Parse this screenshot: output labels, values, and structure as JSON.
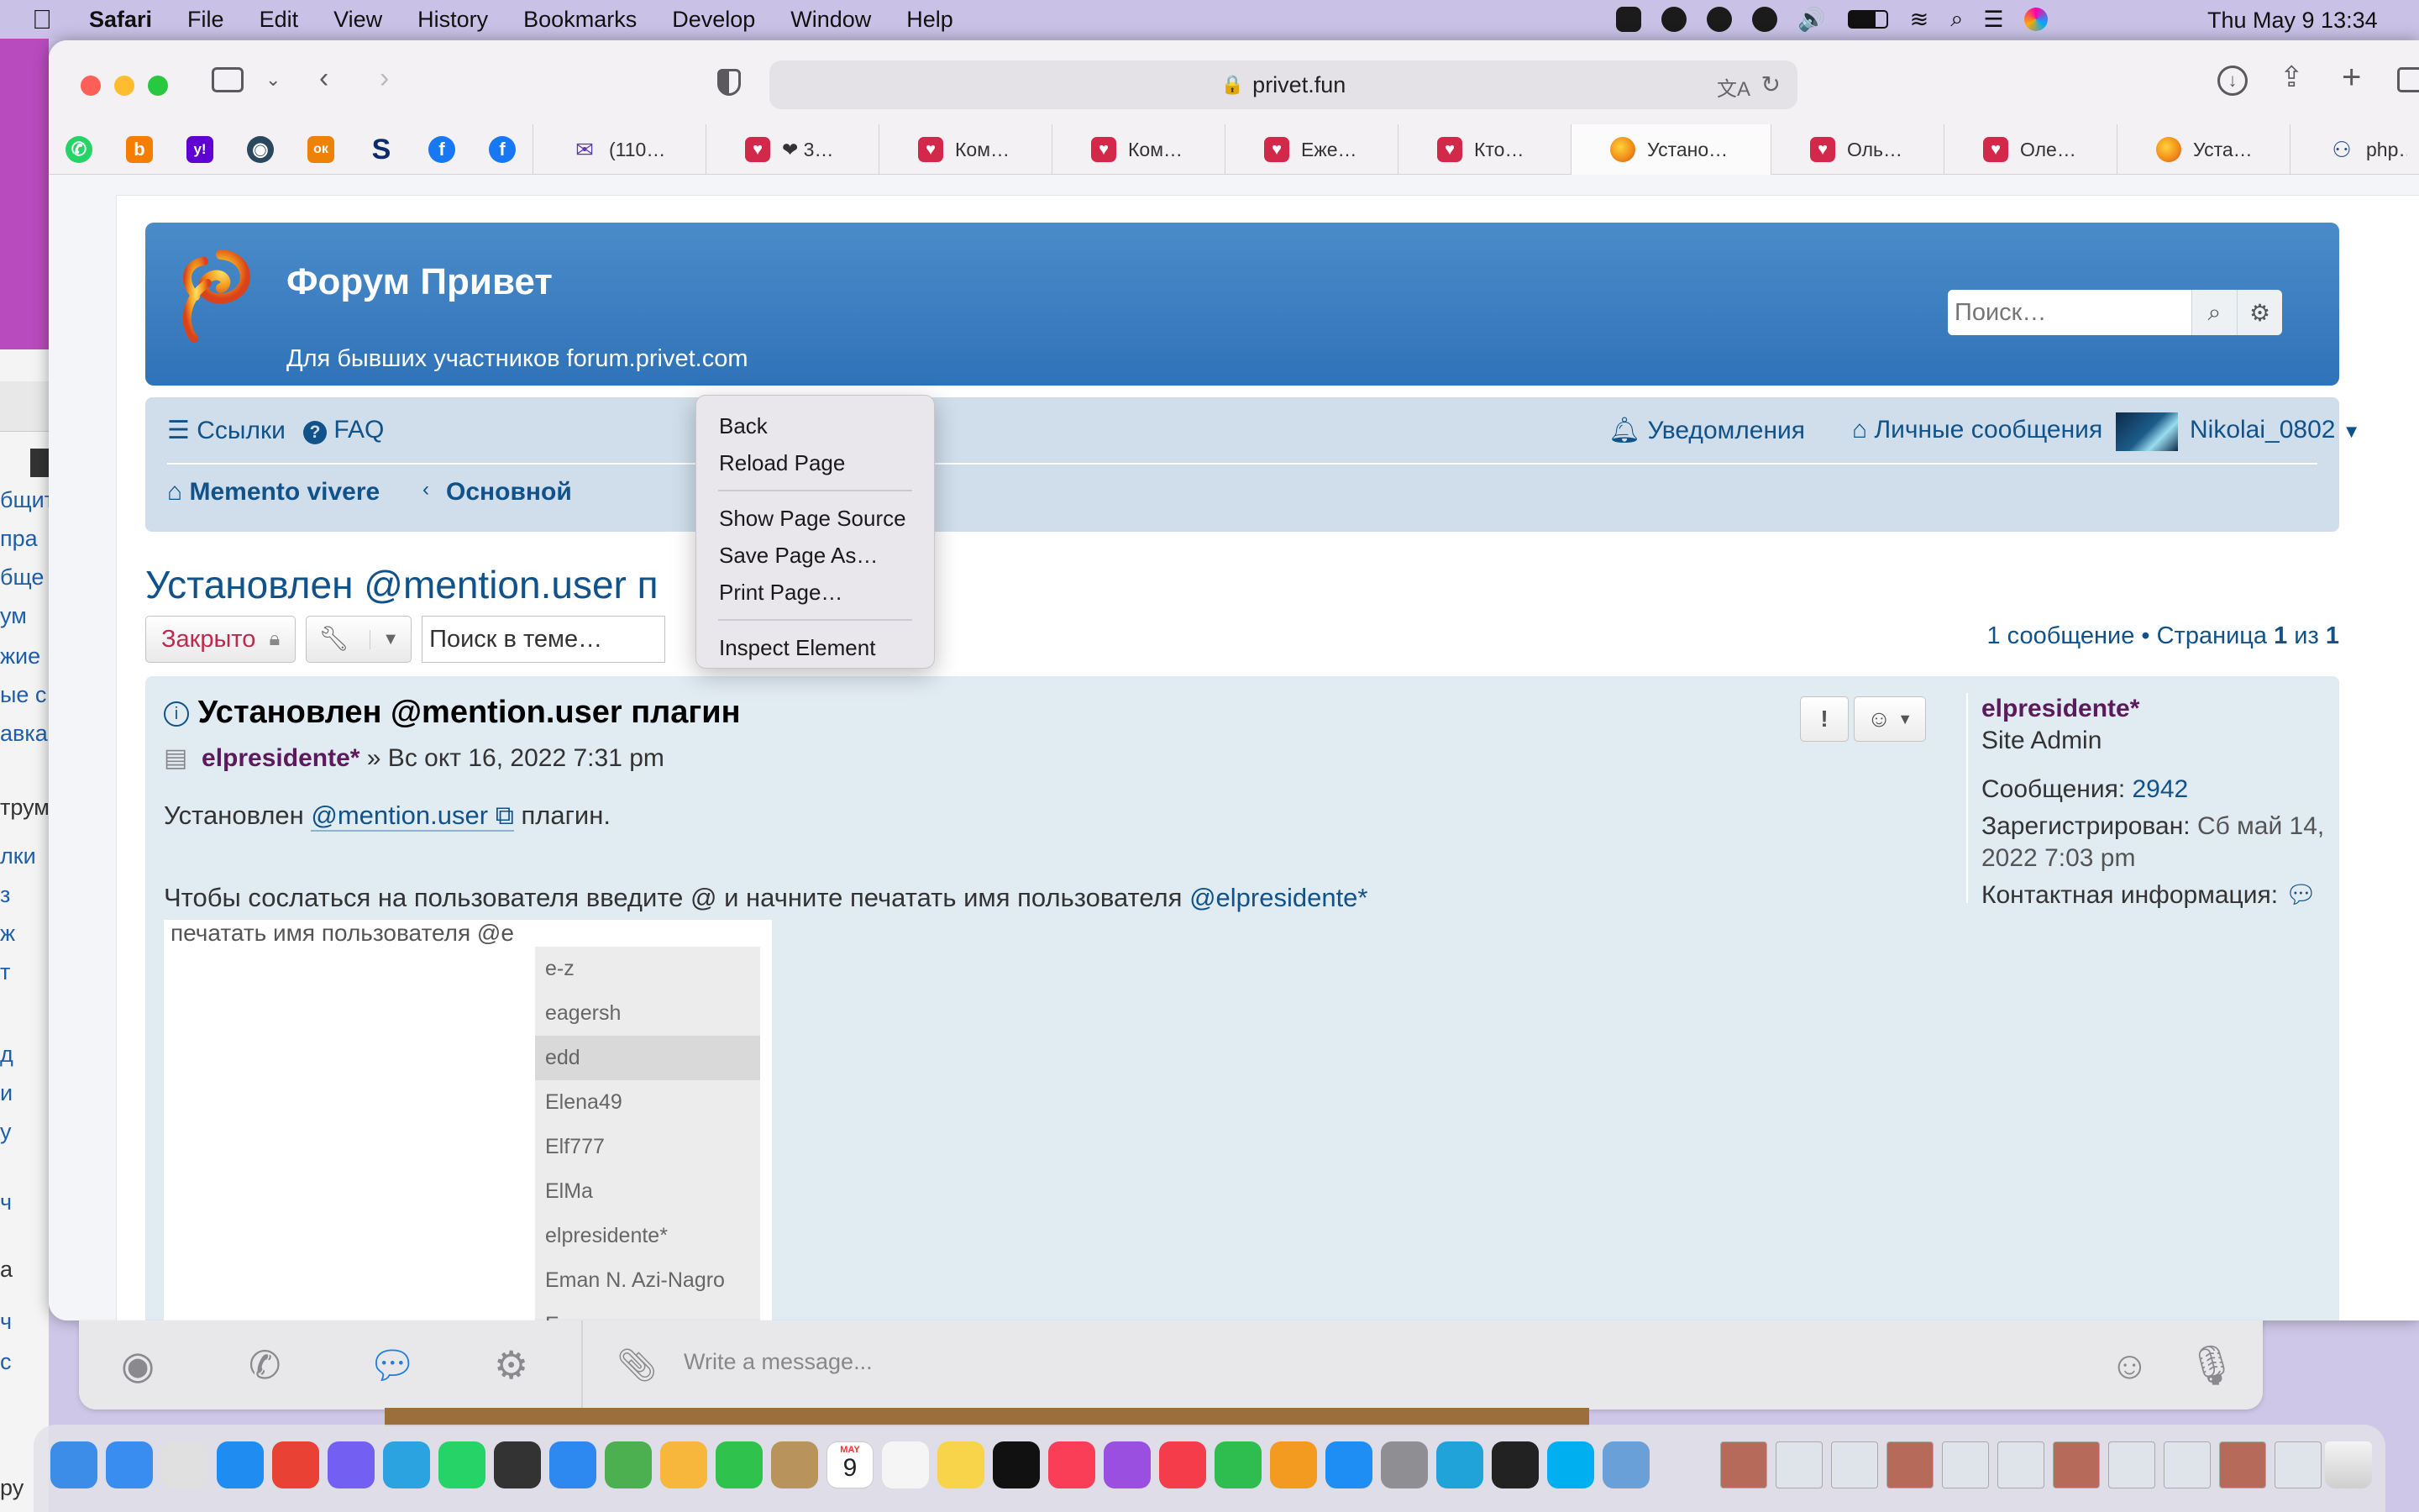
{
  "menubar": {
    "apple": "",
    "items": [
      "Safari",
      "File",
      "Edit",
      "View",
      "History",
      "Bookmarks",
      "Develop",
      "Window",
      "Help"
    ],
    "clock": "Thu May 9  13:34"
  },
  "left_window": {
    "lines": [
      "бщит",
      "пра",
      "бще",
      "ум",
      "жие",
      "ые с",
      "авка",
      "трум",
      "лки",
      "з",
      "ж",
      "т",
      "д",
      "и",
      "у",
      "ч",
      "а",
      "ч",
      "с",
      "ру"
    ]
  },
  "safari": {
    "url": "privet.fun",
    "favorites": [
      {
        "icon": "whatsapp-icon",
        "color": "#25d366",
        "glyph": "✆"
      },
      {
        "icon": "blogger-icon",
        "color": "#f57d00",
        "glyph": "b"
      },
      {
        "icon": "yahoo-icon",
        "color": "#5f01d1",
        "glyph": "y!"
      },
      {
        "icon": "steam-icon",
        "color": "#2a475e",
        "glyph": "◉"
      },
      {
        "icon": "odnoklassniki-icon",
        "color": "#ee8208",
        "glyph": "ок"
      },
      {
        "icon": "skype-s-icon",
        "color": "#0b2d6b",
        "glyph": "S"
      },
      {
        "icon": "facebook-icon",
        "color": "#1877f2",
        "glyph": "f"
      },
      {
        "icon": "facebook-icon",
        "color": "#1877f2",
        "glyph": "f"
      }
    ],
    "tabs": [
      {
        "label": "(110…",
        "icon": "mail-icon",
        "active": false
      },
      {
        "label": "❤ 3…",
        "icon": "heart-icon",
        "active": false
      },
      {
        "label": "Ком…",
        "icon": "heart-icon",
        "active": false
      },
      {
        "label": "Ком…",
        "icon": "heart-icon",
        "active": false
      },
      {
        "label": "Еже…",
        "icon": "heart-icon",
        "active": false
      },
      {
        "label": "Кто…",
        "icon": "heart-icon",
        "active": false
      },
      {
        "label": "Устано…",
        "icon": "forum-logo-icon",
        "active": true
      },
      {
        "label": "Оль…",
        "icon": "heart-icon",
        "active": false
      },
      {
        "label": "Оле…",
        "icon": "heart-icon",
        "active": false
      },
      {
        "label": "Уста…",
        "icon": "forum-logo-icon",
        "active": false
      },
      {
        "label": "php…",
        "icon": "users-icon",
        "active": false
      }
    ]
  },
  "forum": {
    "site_title": "Форум Привет",
    "site_desc": "Для бывших участников forum.privet.com",
    "search_placeholder": "Поиск…",
    "nav": {
      "links": "Ссылки",
      "faq": "FAQ",
      "notifications": "Уведомления",
      "messages": "Личные сообщения",
      "username": "Nikolai_0802",
      "crumb1": "Memento vivere",
      "crumb2": "Основной"
    },
    "topic_title": "Установлен @mention.user п",
    "closed_label": "Закрыто",
    "topic_search_placeholder": "Поиск в теме…",
    "pagination": {
      "pre": "1 сообщение • Страница ",
      "page": "1",
      "mid": " из ",
      "total": "1"
    },
    "post": {
      "title": "Установлен @mention.user плагин",
      "author": "elpresidente*",
      "date": " » Вс окт 16, 2022 7:31 pm",
      "body1_pre": "Установлен ",
      "body1_link": "@mention.user",
      "body1_post": " плагин.",
      "body2_pre": "Чтобы сослаться на пользователя введите @ и начните печатать имя пользователя ",
      "body2_mention": "@elpresidente*",
      "image_caption": "печатать имя пользователя @e",
      "suggestions": [
        "e-z",
        "eagersh",
        "edd",
        "Elena49",
        "Elf777",
        "ElMa",
        "elpresidente*",
        "Eman N. Azi-Nagro",
        "E…"
      ]
    },
    "profile": {
      "name": "elpresidente*",
      "rank": "Site Admin",
      "posts_label": "Сообщения: ",
      "posts_value": "2942",
      "joined_label": "Зарегистрирован:",
      "joined_value": " Сб май 14, 2022 7:03 pm",
      "contact_label": "Контактная информация:"
    }
  },
  "context_menu": {
    "items": [
      "Back",
      "Reload Page",
      "Show Page Source",
      "Save Page As…",
      "Print Page…",
      "Inspect Element"
    ]
  },
  "chat": {
    "placeholder": "Write a message..."
  },
  "dock": {
    "apps": [
      {
        "name": "finder",
        "color": "#3b8de8"
      },
      {
        "name": "mail",
        "color": "#3a8df0"
      },
      {
        "name": "launchpad",
        "color": "#e0e0e0"
      },
      {
        "name": "safari",
        "color": "#1e8cf0"
      },
      {
        "name": "chrome",
        "color": "#e94235"
      },
      {
        "name": "viber",
        "color": "#7360f2"
      },
      {
        "name": "telegram",
        "color": "#2aa3e0"
      },
      {
        "name": "whatsapp",
        "color": "#25d366"
      },
      {
        "name": "calculator",
        "color": "#333"
      },
      {
        "name": "keynote",
        "color": "#2d89ef"
      },
      {
        "name": "maps",
        "color": "#4cb050"
      },
      {
        "name": "photos",
        "color": "#f6b73c"
      },
      {
        "name": "facetime",
        "color": "#2fc24d"
      },
      {
        "name": "contacts",
        "color": "#b8935c"
      },
      {
        "name": "calendar",
        "color": "#ffffff"
      },
      {
        "name": "reminders",
        "color": "#f5f5f5"
      },
      {
        "name": "notes",
        "color": "#f7d44a"
      },
      {
        "name": "tv",
        "color": "#111"
      },
      {
        "name": "music",
        "color": "#fa3e57"
      },
      {
        "name": "podcasts",
        "color": "#9b4fe0"
      },
      {
        "name": "news",
        "color": "#f53c4b"
      },
      {
        "name": "numbers",
        "color": "#2ebe4f"
      },
      {
        "name": "pages",
        "color": "#f39a20"
      },
      {
        "name": "appstore",
        "color": "#1e8ef5"
      },
      {
        "name": "settings",
        "color": "#8e8e93"
      },
      {
        "name": "mk",
        "color": "#1fa3d8"
      },
      {
        "name": "weather-widget",
        "color": "#222"
      },
      {
        "name": "skype",
        "color": "#00aff0"
      },
      {
        "name": "preview",
        "color": "#6aa0d8"
      }
    ],
    "calendar_month": "MAY",
    "calendar_day": "9"
  }
}
